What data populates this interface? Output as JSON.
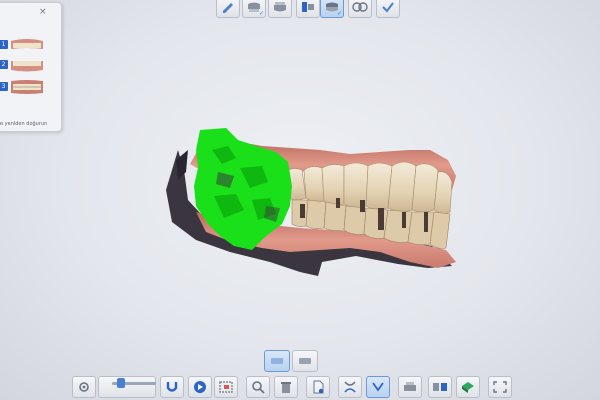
{
  "left_panel": {
    "close_glyph": "×",
    "scans": [
      {
        "number": "1",
        "thumb": "upper-jaw-scan-thumbnail"
      },
      {
        "number": "2",
        "thumb": "lower-jaw-scan-thumbnail"
      },
      {
        "number": "3",
        "thumb": "bite-scan-thumbnail"
      }
    ],
    "caption": "e yeniden doğurun"
  },
  "top_toolbar": [
    {
      "name": "pen-tool-icon",
      "active": false,
      "checked": false
    },
    {
      "name": "upper-jaw-icon",
      "active": false,
      "checked": true
    },
    {
      "name": "lower-jaw-icon",
      "active": false,
      "checked": false
    },
    {
      "name": "scan-bite-icon",
      "active": true,
      "checked": true
    },
    {
      "name": "occlusion-icon",
      "active": false,
      "checked": false
    },
    {
      "name": "confirm-check-icon",
      "active": false,
      "checked": false
    }
  ],
  "view_toggle": [
    {
      "name": "view-upper-icon",
      "active": true
    },
    {
      "name": "view-lower-icon",
      "active": false
    }
  ],
  "bottom_toolbar": [
    {
      "name": "settings-icon"
    },
    {
      "name": "magnet-icon"
    },
    {
      "name": "play-icon"
    },
    {
      "name": "selection-tool-icon"
    },
    {
      "name": "zoom-icon"
    },
    {
      "name": "trash-icon"
    },
    {
      "name": "document-icon"
    },
    {
      "name": "jaw-open-icon"
    },
    {
      "name": "jaw-active-icon"
    },
    {
      "name": "printer-icon"
    },
    {
      "name": "transfer-icon"
    },
    {
      "name": "model-icon"
    },
    {
      "name": "fullscreen-icon"
    }
  ],
  "zoom_slider_level": 0.15,
  "colors": {
    "accent": "#2d64c8",
    "highlight_green": "#19e019",
    "gingiva": "#d98b7e",
    "tooth": "#e9dcc2"
  }
}
